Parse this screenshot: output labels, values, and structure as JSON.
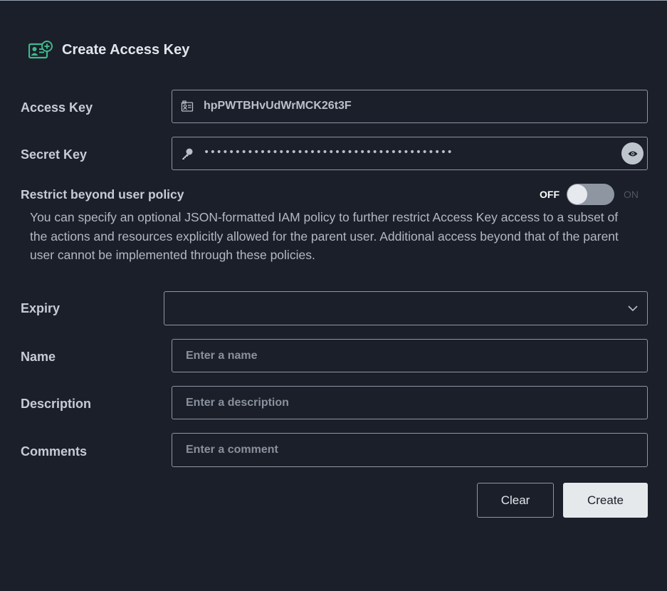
{
  "header": {
    "title": "Create Access Key",
    "icon": "add-credentials-icon"
  },
  "access_key": {
    "label": "Access Key",
    "value": "hpPWTBHvUdWrMCK26t3F",
    "icon": "id-card-icon"
  },
  "secret_key": {
    "label": "Secret Key",
    "value": "••••••••••••••••••••••••••••••••••••••••",
    "icon": "key-icon",
    "reveal_icon": "eye-icon"
  },
  "restrict": {
    "label": "Restrict beyond user policy",
    "toggle_off_label": "OFF",
    "toggle_on_label": "ON",
    "enabled": false,
    "description": "You can specify an optional JSON-formatted IAM policy to further restrict Access Key access to a subset of the actions and resources explicitly allowed for the parent user. Additional access beyond that of the parent user cannot be implemented through these policies."
  },
  "expiry": {
    "label": "Expiry",
    "value": "",
    "icon": "chevron-down-icon"
  },
  "name": {
    "label": "Name",
    "placeholder": "Enter a name",
    "value": ""
  },
  "description": {
    "label": "Description",
    "placeholder": "Enter a description",
    "value": ""
  },
  "comments": {
    "label": "Comments",
    "placeholder": "Enter a comment",
    "value": ""
  },
  "actions": {
    "clear_label": "Clear",
    "create_label": "Create"
  },
  "colors": {
    "background": "#1b1f2a",
    "accent_green": "#3fb98a",
    "field_border": "#8d96a3"
  }
}
